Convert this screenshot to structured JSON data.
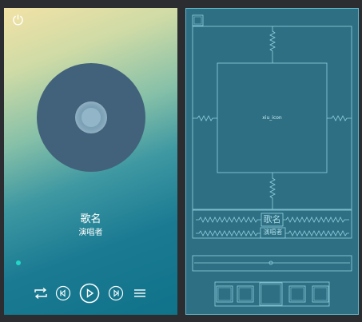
{
  "player": {
    "song_title": "歌名",
    "artist": "演唱者",
    "progress": 0,
    "controls": {
      "repeat": "repeat-icon",
      "previous": "previous-track-icon",
      "play": "play-icon",
      "next": "next-track-icon",
      "menu": "playlist-menu-icon"
    },
    "power": "power-icon"
  },
  "blueprint": {
    "image_label": "xiu_icon",
    "song_title": "歌名",
    "artist": "演唱者"
  },
  "colors": {
    "disc": "#41627a",
    "progress_accent": "#22d6c8",
    "blueprint_bg": "#2f6f84",
    "blueprint_line": "#5fb7c9"
  }
}
